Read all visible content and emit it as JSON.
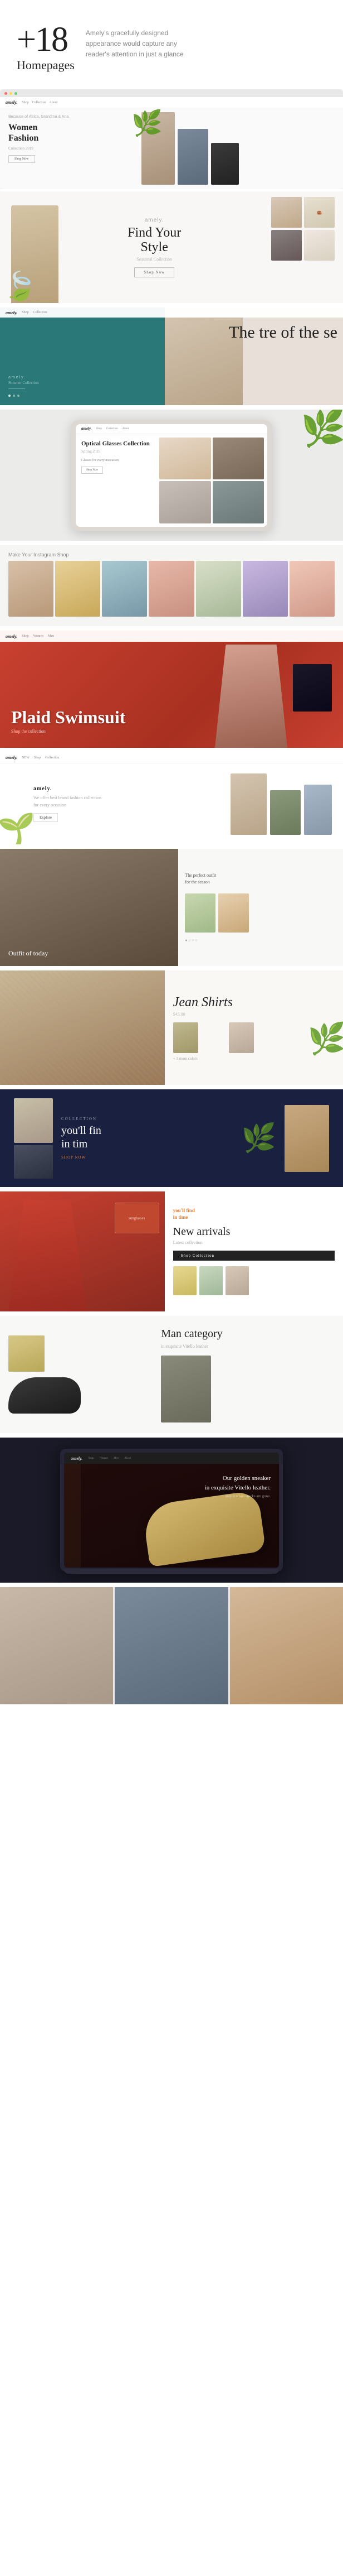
{
  "hero": {
    "count": "+18",
    "label": "Homepages",
    "description": "Amely's gracefully designed appearance would capture any reader's attention in just a glance"
  },
  "previews": [
    {
      "id": "preview-women-fashion",
      "nav": "amely.",
      "tag": "Because of Africa, Grandma & Ana",
      "heading": "Women\nFashion",
      "subtext": "Collection 2019"
    },
    {
      "id": "preview-find-style",
      "title": "Find Your\nStyle",
      "subtitle": "Seasonal Collection",
      "button": "Shop Now"
    },
    {
      "id": "preview-teal-trend",
      "brand": "amely.",
      "collection": "Summer Collection",
      "title": "The tre\nof the se"
    },
    {
      "id": "preview-optical",
      "title": "Optical Glasses\nCollection",
      "subtitle": "Spring 2019"
    },
    {
      "id": "preview-instagram",
      "label": "Make Your Instagram Shop"
    },
    {
      "id": "preview-swimsuit",
      "title": "Plaid\nSwimsuit",
      "subtitle": ""
    },
    {
      "id": "preview-minimal",
      "brand": "amely.",
      "description": "We offer best brand fashion collection\nfor every occasion"
    },
    {
      "id": "preview-outfit",
      "label": "Outfit of today"
    },
    {
      "id": "preview-floral",
      "title": "Jean Shirts",
      "price": "$45.00"
    },
    {
      "id": "preview-dark-navy",
      "label": "COLLECTION",
      "title": "you'll fin\nin tim",
      "cta": "SHOP NOW"
    },
    {
      "id": "preview-new-arrivals",
      "title": "New arrivals",
      "subtitle": "Latest collection",
      "button": "Shop Collection",
      "orange_text": "you'll find\nin time"
    },
    {
      "id": "preview-man-category",
      "title": "Man category",
      "subtitle": "in exquisite Vitello leather"
    },
    {
      "id": "preview-laptop",
      "brand": "amely.",
      "slogan": "Our golden sneaker\nin exquisite Vitello leather.",
      "sub": "Buy it while stocks are gone."
    },
    {
      "id": "preview-final-models",
      "label": ""
    }
  ],
  "colors": {
    "accent_teal": "#2a7a7a",
    "accent_red": "#c84030",
    "accent_navy": "#1a2040",
    "accent_dark": "#1a1a2a",
    "text_dark": "#222222",
    "text_light": "#aaaaaa",
    "bg_light": "#fafafa",
    "orange": "#e08040"
  }
}
